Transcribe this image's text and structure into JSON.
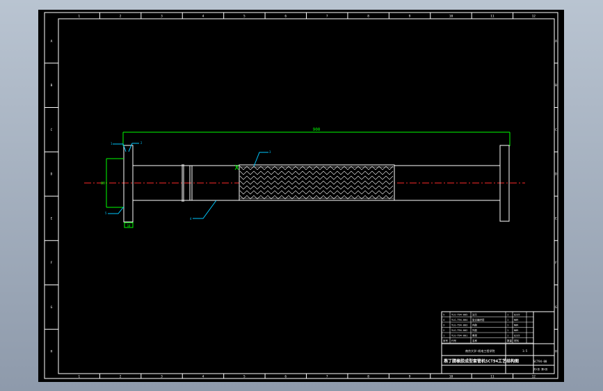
{
  "colors": {
    "background_outer": "#a3afbe",
    "canvas": "#000000",
    "line": "#ffffff",
    "centerline": "#ff2a2a",
    "dimension": "#00ff00",
    "leader": "#00c8ff",
    "border_label": "#ffffff"
  },
  "border": {
    "top_labels": [
      "1",
      "2",
      "3",
      "4",
      "5",
      "6",
      "7",
      "8",
      "9",
      "10",
      "11",
      "12"
    ],
    "bottom_labels": [
      "1",
      "2",
      "3",
      "4",
      "5",
      "6",
      "7",
      "8",
      "9",
      "10",
      "11",
      "12"
    ],
    "left_labels": [
      "A",
      "B",
      "C",
      "D",
      "E",
      "F",
      "G",
      "H"
    ],
    "right_labels": [
      "A",
      "B",
      "C",
      "D",
      "E",
      "F",
      "G",
      "H"
    ]
  },
  "annotations": {
    "overall_length": "900",
    "flange_dim": "80",
    "flange_bottom_dim": "10",
    "balloons": [
      "1",
      "2",
      "3",
      "4",
      "5"
    ]
  },
  "title_block": {
    "main_title": "燕丁腈橡胶成型套管机SCT94工艺结构图",
    "organization": "南京大学—机电工程学院",
    "bom_rows": [
      [
        "5",
        "YLG-T94-005",
        "法兰",
        "1",
        "Q235"
      ],
      [
        "4",
        "YLG-T94-004",
        "复合编织层",
        "1",
        "NBR"
      ],
      [
        "3",
        "YLG-T94-003",
        "内胶",
        "1",
        "NBR"
      ],
      [
        "2",
        "YLG-T94-002",
        "外胶",
        "1",
        "NBR"
      ],
      [
        "1",
        "YLG-T94-001",
        "骨架",
        "1",
        "Q235"
      ]
    ],
    "header_labels": [
      "序号",
      "代号",
      "名称",
      "数量",
      "材料"
    ],
    "scale": "1:5",
    "sheet": "共1张 第1张",
    "drawing_no": "SCT94-00"
  },
  "icons": [
    "centerline-marker-icon"
  ]
}
